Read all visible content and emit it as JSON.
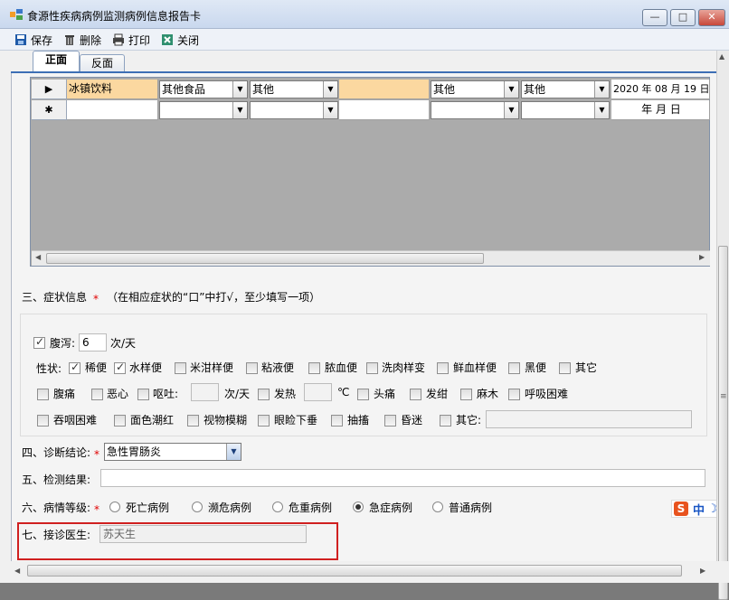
{
  "window": {
    "title": "食源性疾病病例监测病例信息报告卡",
    "controls": {
      "min": "—",
      "max": "□",
      "close": "✕"
    }
  },
  "toolbar": {
    "save": "保存",
    "delete": "删除",
    "print": "打印",
    "close": "关闭"
  },
  "tabs": [
    {
      "label": "正面"
    },
    {
      "label": "反面"
    }
  ],
  "grid": {
    "rows": [
      {
        "marker": "▶",
        "cells": [
          "冰镇饮料",
          "其他食品",
          "其他",
          "",
          "其他",
          "其他",
          "2020 年 08 月 19 日"
        ]
      },
      {
        "marker": "✱",
        "cells": [
          "",
          "",
          "",
          "",
          "",
          "",
          "年  月  日"
        ]
      }
    ]
  },
  "symptoms": {
    "heading": "三、症状信息",
    "hint": "（在相应症状的“口”中打√，至少填写一项）",
    "diarrhea_label": "腹泻:",
    "diarrhea_value": "6",
    "diarrhea_unit": "次/天",
    "nature_label": "性状:",
    "nature_options": [
      {
        "label": "稀便",
        "checked": true
      },
      {
        "label": "水样便",
        "checked": true
      },
      {
        "label": "米泔样便",
        "checked": false
      },
      {
        "label": "粘液便",
        "checked": false
      },
      {
        "label": "脓血便",
        "checked": false
      },
      {
        "label": "洗肉样变",
        "checked": false
      },
      {
        "label": "鲜血样便",
        "checked": false
      },
      {
        "label": "黑便",
        "checked": false
      },
      {
        "label": "其它",
        "checked": false
      }
    ],
    "row3": {
      "abdominal_pain": "腹痛",
      "nausea": "恶心",
      "vomit": "呕吐:",
      "vomit_unit": "次/天",
      "fever": "发热",
      "fever_unit": "℃",
      "headache": "头痛",
      "cyanosis": "发绀",
      "numbness": "麻木",
      "dyspnea": "呼吸困难"
    },
    "row4": {
      "dysphagia": "吞咽困难",
      "flushing": "面色潮红",
      "blurred_vision": "视物模糊",
      "ptosis": "眼睑下垂",
      "convulsion": "抽搐",
      "coma": "昏迷",
      "other": "其它:"
    }
  },
  "diagnosis": {
    "label": "四、诊断结论:",
    "value": "急性胃肠炎"
  },
  "test_result": {
    "label": "五、检测结果:",
    "value": ""
  },
  "severity": {
    "label": "六、病情等级:",
    "options": [
      {
        "label": "死亡病例",
        "selected": false
      },
      {
        "label": "濒危病例",
        "selected": false
      },
      {
        "label": "危重病例",
        "selected": false
      },
      {
        "label": "急症病例",
        "selected": true
      },
      {
        "label": "普通病例",
        "selected": false
      }
    ]
  },
  "doctor": {
    "label": "七、接诊医生:",
    "value": "苏天生"
  },
  "ime": {
    "brand": "S",
    "mode": "中",
    "moon": "☽"
  },
  "colors": {
    "accent": "#3d6fb5",
    "highlight_row": "#fbd8a0",
    "required": "#e00000",
    "doctor_border": "#d02020"
  }
}
